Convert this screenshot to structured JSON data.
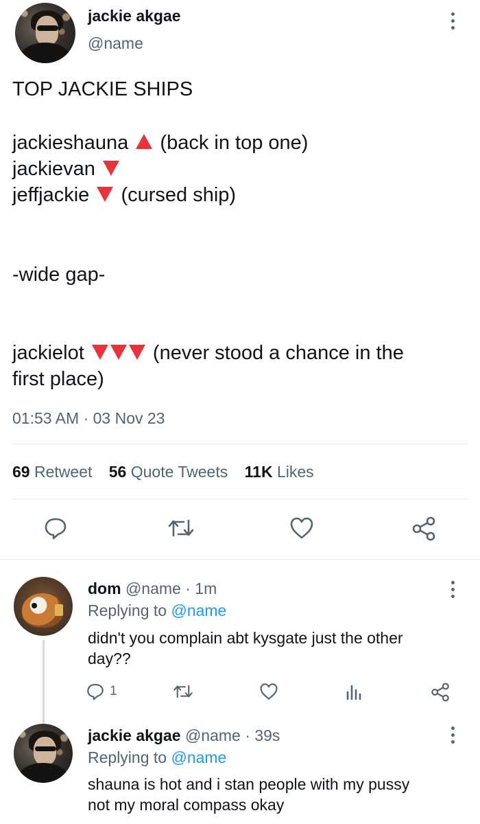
{
  "main_tweet": {
    "display_name": "jackie akgae",
    "handle": "@name",
    "lines": [
      "TOP JACKIE SHIPS",
      "jackieshauna",
      "(back in top one)",
      "jackievan",
      "jeffjackie",
      "(cursed ship)",
      "-wide gap-",
      "jackielot",
      "(never stood a chance in the",
      "first place)"
    ],
    "timestamp": "01:53 AM · 03 Nov 23",
    "stats": {
      "retweets_count": "69",
      "retweets_label": "Retweet",
      "quotes_count": "56",
      "quotes_label": "Quote Tweets",
      "likes_count": "11K",
      "likes_label": "Likes"
    },
    "actions": [
      "reply-icon",
      "retweet-icon",
      "like-icon",
      "share-icon"
    ]
  },
  "replies": [
    {
      "display_name": "dom",
      "handle": "@name",
      "time": "· 1m",
      "replying_prefix": "Replying to",
      "replying_handle": "@name",
      "text_line1": "didn't you complain abt kysgate just the other",
      "text_line2": "day??",
      "reply_count": "1",
      "actions": [
        "reply-icon",
        "retweet-icon",
        "like-icon",
        "analytics-icon",
        "share-icon"
      ]
    },
    {
      "display_name": "jackie akgae",
      "handle": "@name",
      "time": "· 39s",
      "replying_prefix": "Replying to",
      "replying_handle": "@name",
      "text_line1": "shauna is hot and i stan people with my pussy",
      "text_line2": "not my moral compass okay"
    }
  ],
  "colors": {
    "text": "#0f1419",
    "muted": "#536471",
    "link": "#1d9bf0",
    "triangle_red": "#e8323c",
    "divider": "#e7e9ea"
  }
}
